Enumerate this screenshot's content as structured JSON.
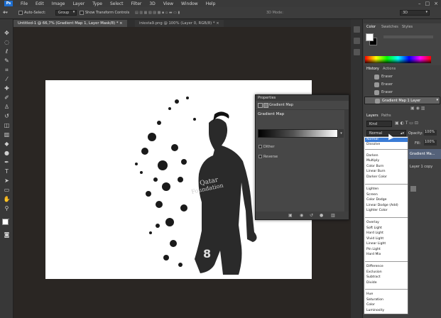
{
  "app": {
    "logo": "Ps",
    "menu": [
      "File",
      "Edit",
      "Image",
      "Layer",
      "Type",
      "Select",
      "Filter",
      "3D",
      "View",
      "Window",
      "Help"
    ],
    "window_controls": [
      "–",
      "□",
      "×"
    ]
  },
  "options_bar": {
    "auto_select_label": "Auto-Select:",
    "auto_select_value": "Group",
    "transform_label": "Show Transform Controls",
    "mode_label": "3D Mode:",
    "workspace_value": "3D"
  },
  "tabs": [
    {
      "label": "Untitled-1 @ 66,7% (Gradient Map 1, Layer Mask/8) *",
      "close": "×"
    },
    {
      "label": "iniesta9.png @ 100% (Layer 0, RGB/8) *",
      "close": "×"
    }
  ],
  "properties": {
    "panel_title": "Properties",
    "header": "Gradient Map",
    "section": "Gradient Map",
    "option_dither": "Dither",
    "option_reverse": "Reverse",
    "dropdown_arrow": "▾"
  },
  "color_panel": {
    "tabs": [
      "Color",
      "Swatches",
      "Styles"
    ]
  },
  "history_panel": {
    "tabs": [
      "History",
      "Actions"
    ],
    "items": [
      "Eraser",
      "Eraser",
      "Eraser",
      "Gradient Map 1 Layer"
    ]
  },
  "layers_panel": {
    "tabs": [
      "Layers",
      "Paths"
    ],
    "kind_label": "Kind",
    "blend_value": "Normal",
    "opacity_label": "Opacity:",
    "opacity_value": "100%",
    "fill_label": "Fill:",
    "fill_value": "100%",
    "layer_gradient": "Gradient Ma...",
    "layer_copy": "Layer 1 copy"
  },
  "blend_modes": {
    "groups": [
      [
        "Normal",
        "Dissolve"
      ],
      [
        "Darken",
        "Multiply",
        "Color Burn",
        "Linear Burn",
        "Darker Color"
      ],
      [
        "Lighten",
        "Screen",
        "Color Dodge",
        "Linear Dodge (Add)",
        "Lighter Color"
      ],
      [
        "Overlay",
        "Soft Light",
        "Hard Light",
        "Vivid Light",
        "Linear Light",
        "Pin Light",
        "Hard Mix"
      ],
      [
        "Difference",
        "Exclusion",
        "Subtract",
        "Divide"
      ],
      [
        "Hue",
        "Saturation",
        "Color",
        "Luminosity"
      ]
    ],
    "highlighted": "Normal"
  },
  "canvas_image": {
    "jersey_text": [
      "Qatar",
      "Foundation"
    ],
    "number": "8"
  }
}
